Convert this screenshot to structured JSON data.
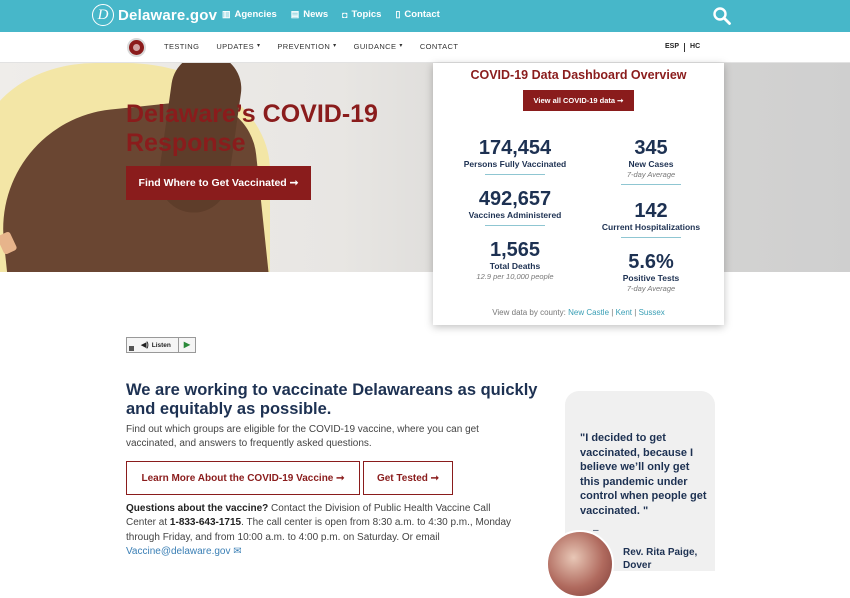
{
  "topbar": {
    "site_name": "Delaware.gov",
    "links": [
      "Agencies",
      "News",
      "Topics",
      "Contact"
    ]
  },
  "subnav": {
    "items": [
      {
        "label": "TESTING",
        "caret": false
      },
      {
        "label": "UPDATES",
        "caret": true
      },
      {
        "label": "PREVENTION",
        "caret": true
      },
      {
        "label": "GUIDANCE",
        "caret": true
      },
      {
        "label": "CONTACT",
        "caret": false
      }
    ],
    "lang_esp": "ESP",
    "lang_hc": "HC"
  },
  "hero": {
    "title": "Delaware’s COVID-19 Response",
    "button": "Find Where to Get Vaccinated ➞"
  },
  "dashboard": {
    "title": "COVID-19 Data Dashboard Overview",
    "button": "View all COVID-19 data ➞",
    "stats": {
      "fully_vaccinated": {
        "value": "174,454",
        "label": "Persons Fully Vaccinated"
      },
      "new_cases": {
        "value": "345",
        "label": "New Cases",
        "sub": "7-day Average"
      },
      "administered": {
        "value": "492,657",
        "label": "Vaccines Administered"
      },
      "hospitalizations": {
        "value": "142",
        "label": "Current Hospitalizations"
      },
      "deaths": {
        "value": "1,565",
        "label": "Total Deaths",
        "sub": "12.9 per 10,000 people"
      },
      "positive": {
        "value": "5.6%",
        "label": "Positive Tests",
        "sub": "7-day Average"
      }
    },
    "county_prefix": "View data by county:",
    "counties": [
      "New Castle",
      "Kent",
      "Sussex"
    ]
  },
  "listen": {
    "label": "Listen"
  },
  "main": {
    "title": "We are working to vaccinate Delawareans as quickly and equitably as possible.",
    "paragraph": "Find out which groups are eligible for the COVID-19 vaccine, where you can get vaccinated, and answers to frequently asked questions.",
    "btn_learn": "Learn More About the COVID-19 Vaccine ➞",
    "btn_tested": "Get Tested ➞",
    "contact_q": "Questions about the vaccine?",
    "contact_text1": " Contact the Division of Public Health Vaccine Call Center at ",
    "phone": "1-833-643-1715",
    "contact_text2": ". The call center is open from 8:30 a.m. to 4:30 p.m., Monday through Friday, and from 10:00 a.m. to 4:00 p.m. on Saturday. Or email ",
    "email": "Vaccine@delaware.gov"
  },
  "quote": {
    "text": "\"I decided to get vaccinated, because I believe we’ll only get this pandemic under control when people get vaccinated. \"",
    "dash": "–",
    "author": "Rev. Rita Paige, Dover"
  }
}
